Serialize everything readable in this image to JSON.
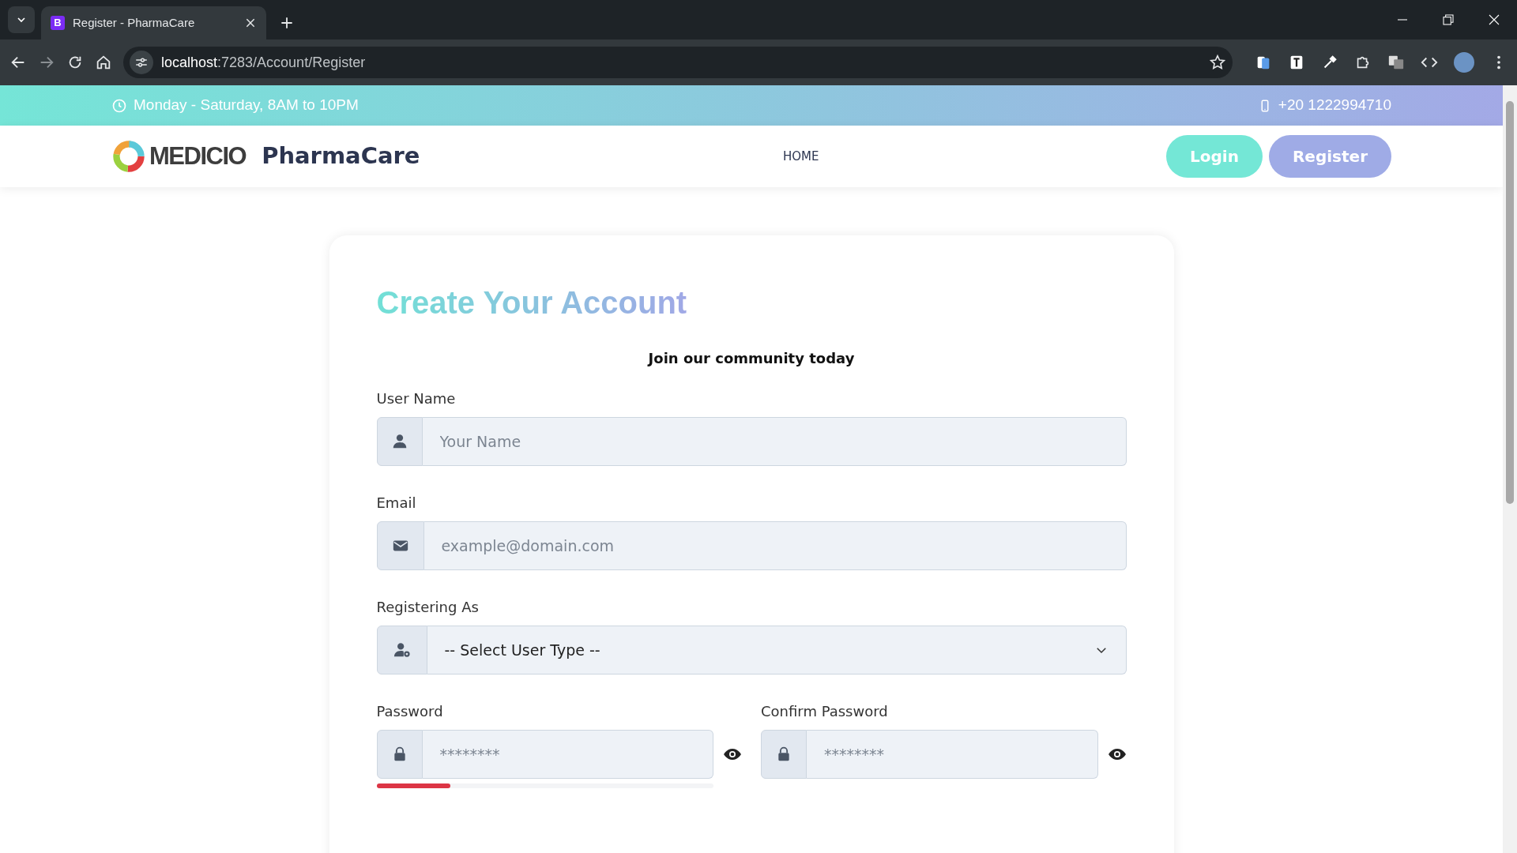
{
  "browser": {
    "tabs": [
      {
        "favicon": "B",
        "title": "Register - PharmaCare",
        "selected": true
      }
    ],
    "address": {
      "host": "localhost",
      "path": ":7283/Account/Register"
    }
  },
  "topbar": {
    "hours": "Monday - Saturday, 8AM to 10PM",
    "phone": "+20 1222994710"
  },
  "navbar": {
    "logo": "MEDICIO",
    "brand": "PharmaCare",
    "links": [
      {
        "label": "HOME"
      }
    ],
    "buttons": [
      {
        "label": "Login",
        "kind": "login"
      },
      {
        "label": "Register",
        "kind": "register"
      }
    ]
  },
  "form": {
    "title": "Create Your Account",
    "subtitle": "Join our community today",
    "fields": [
      {
        "kind": "text",
        "label": "User Name",
        "placeholder": "Your Name"
      },
      {
        "kind": "email",
        "label": "Email",
        "placeholder": "example@domain.com"
      },
      {
        "kind": "select",
        "label": "Registering As",
        "value": "-- Select User Type --"
      }
    ],
    "passwords": [
      {
        "label": "Password",
        "placeholder": "********",
        "strength": {
          "level": 0.22
        }
      },
      {
        "label": "Confirm Password",
        "placeholder": "********"
      }
    ]
  }
}
